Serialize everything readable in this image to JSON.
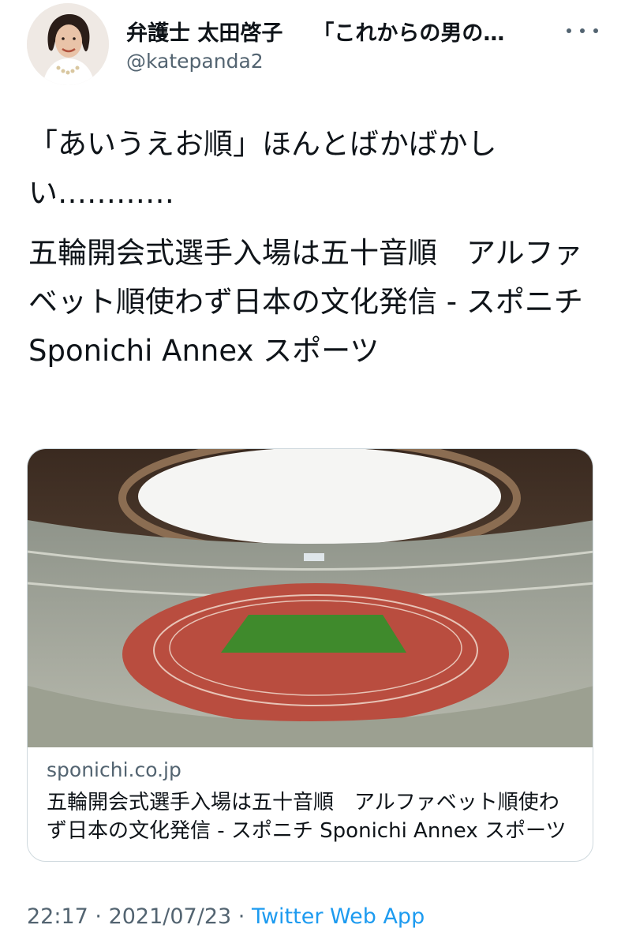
{
  "author": {
    "display_name": "弁護士 太田啓子",
    "bio_snippet": "「これからの男の…",
    "handle": "@katepanda2"
  },
  "tweet": {
    "text_line1": "「あいうえお順」ほんとばかばかしい…………",
    "text_line2": "五輪開会式選手入場は五十音順　アルファベット順使わず日本の文化発信 - スポニチ Sponichi Annex スポーツ"
  },
  "card": {
    "domain": "sponichi.co.jp",
    "title": "五輪開会式選手入場は五十音順　アルファベット順使わず日本の文化発信 - スポニチ Sponichi Annex スポーツ",
    "image_alt": "stadium-photo"
  },
  "meta": {
    "time": "22:17",
    "separator1": " · ",
    "date": "2021/07/23",
    "separator2": " · ",
    "source": "Twitter Web App"
  },
  "colors": {
    "text": "#0f1419",
    "secondary": "#536471",
    "link": "#1d9bf0",
    "border": "#cfd9de"
  }
}
